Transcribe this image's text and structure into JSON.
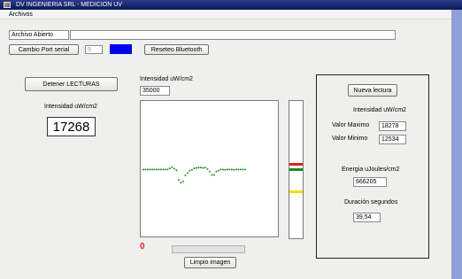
{
  "window": {
    "title": "DV INGENIERIA SRL - MEDICION UV",
    "menu": [
      "Archivos"
    ]
  },
  "file_row": {
    "label": "Archivo Abierto",
    "value": ""
  },
  "serial": {
    "change_port_label": "Cambio Port serial",
    "port_value": "5",
    "status_color": "#0000ee",
    "reset_bluetooth_label": "Reseteo Bluetooth"
  },
  "readings": {
    "stop_label": "Detener LECTURAS",
    "intensity_caption": "Intensidad uW/cm2",
    "intensity_value": "17268"
  },
  "plot": {
    "intensity_label": "Intensidad uW/cm2",
    "scale_value": "35000",
    "counter_value": "0",
    "clear_label": "Limpio imagen",
    "progress": 0
  },
  "chart_data": {
    "type": "scatter",
    "title": "",
    "xlabel": "",
    "ylabel": "Intensidad uW/cm2",
    "ylim": [
      0,
      35000
    ],
    "point_color": "#1a8a1a",
    "points": [
      [
        0,
        17300
      ],
      [
        1,
        17300
      ],
      [
        2,
        17300
      ],
      [
        3,
        17300
      ],
      [
        4,
        17300
      ],
      [
        5,
        17300
      ],
      [
        6,
        17300
      ],
      [
        7,
        17300
      ],
      [
        8,
        17300
      ],
      [
        9,
        17300
      ],
      [
        10,
        17300
      ],
      [
        11,
        17300
      ],
      [
        12,
        17600
      ],
      [
        13,
        17900
      ],
      [
        14,
        17500
      ],
      [
        15,
        17100
      ],
      [
        16,
        14600
      ],
      [
        17,
        13900
      ],
      [
        18,
        14200
      ],
      [
        19,
        15800
      ],
      [
        20,
        16400
      ],
      [
        21,
        17000
      ],
      [
        22,
        17200
      ],
      [
        23,
        17600
      ],
      [
        24,
        17700
      ],
      [
        25,
        17800
      ],
      [
        26,
        17800
      ],
      [
        27,
        17700
      ],
      [
        28,
        17800
      ],
      [
        29,
        17400
      ],
      [
        30,
        16800
      ],
      [
        31,
        15900
      ],
      [
        32,
        15900
      ],
      [
        33,
        16800
      ],
      [
        34,
        17000
      ],
      [
        35,
        17300
      ],
      [
        36,
        17300
      ],
      [
        37,
        17200
      ],
      [
        38,
        17300
      ],
      [
        39,
        17300
      ],
      [
        40,
        17300
      ],
      [
        41,
        17200
      ],
      [
        42,
        17300
      ],
      [
        43,
        17300
      ],
      [
        44,
        17300
      ],
      [
        45,
        17300
      ],
      [
        46,
        17300
      ]
    ]
  },
  "gauge": {
    "bars": [
      {
        "color": "#e02020",
        "level": 0.45
      },
      {
        "color": "#1a8a1a",
        "level": 0.49
      },
      {
        "color": "#f2e000",
        "level": 0.65
      }
    ]
  },
  "stats_panel": {
    "new_reading_label": "Nueva lectura",
    "intensity_title": "Intensidad uW/cm2",
    "max_label": "Valor Maximo",
    "max_value": "18278",
    "min_label": "Valor Minimo",
    "min_value": "12534",
    "energy_label": "Energia   uJoules/cm2",
    "energy_value": "666205",
    "duration_label": "Duración segundos",
    "duration_value": "39,54"
  }
}
